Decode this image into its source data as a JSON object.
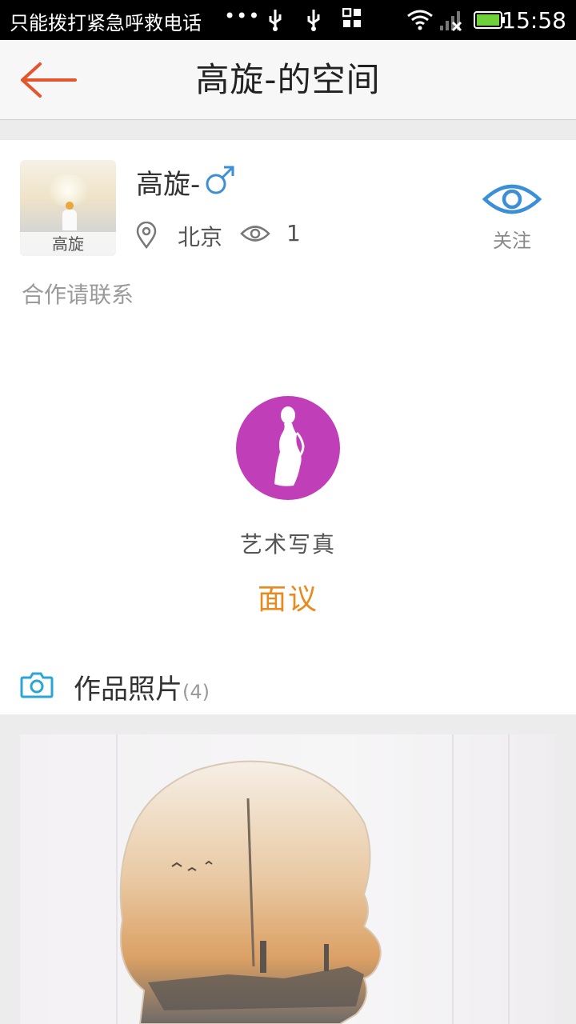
{
  "status_bar": {
    "carrier": "只能拨打紧急呼救电话",
    "dots": "•••",
    "time": "15:58"
  },
  "header": {
    "title": "高旋-的空间",
    "back_icon": "back-arrow-icon"
  },
  "profile": {
    "avatar_caption": "高旋",
    "name": "高旋-",
    "gender_icon": "male-icon",
    "city": "北京",
    "view_count": "1",
    "follow_label": "关注",
    "contact_hint": "合作请联系"
  },
  "service": {
    "icon": "woman-silhouette-icon",
    "name": "艺术写真",
    "price": "面议",
    "icon_color": "#c03fb8",
    "price_color": "#e98a1e"
  },
  "photos": {
    "title": "作品照片",
    "count": "(4)"
  },
  "colors": {
    "accent": "#e4552b",
    "follow": "#3b8fd6"
  }
}
